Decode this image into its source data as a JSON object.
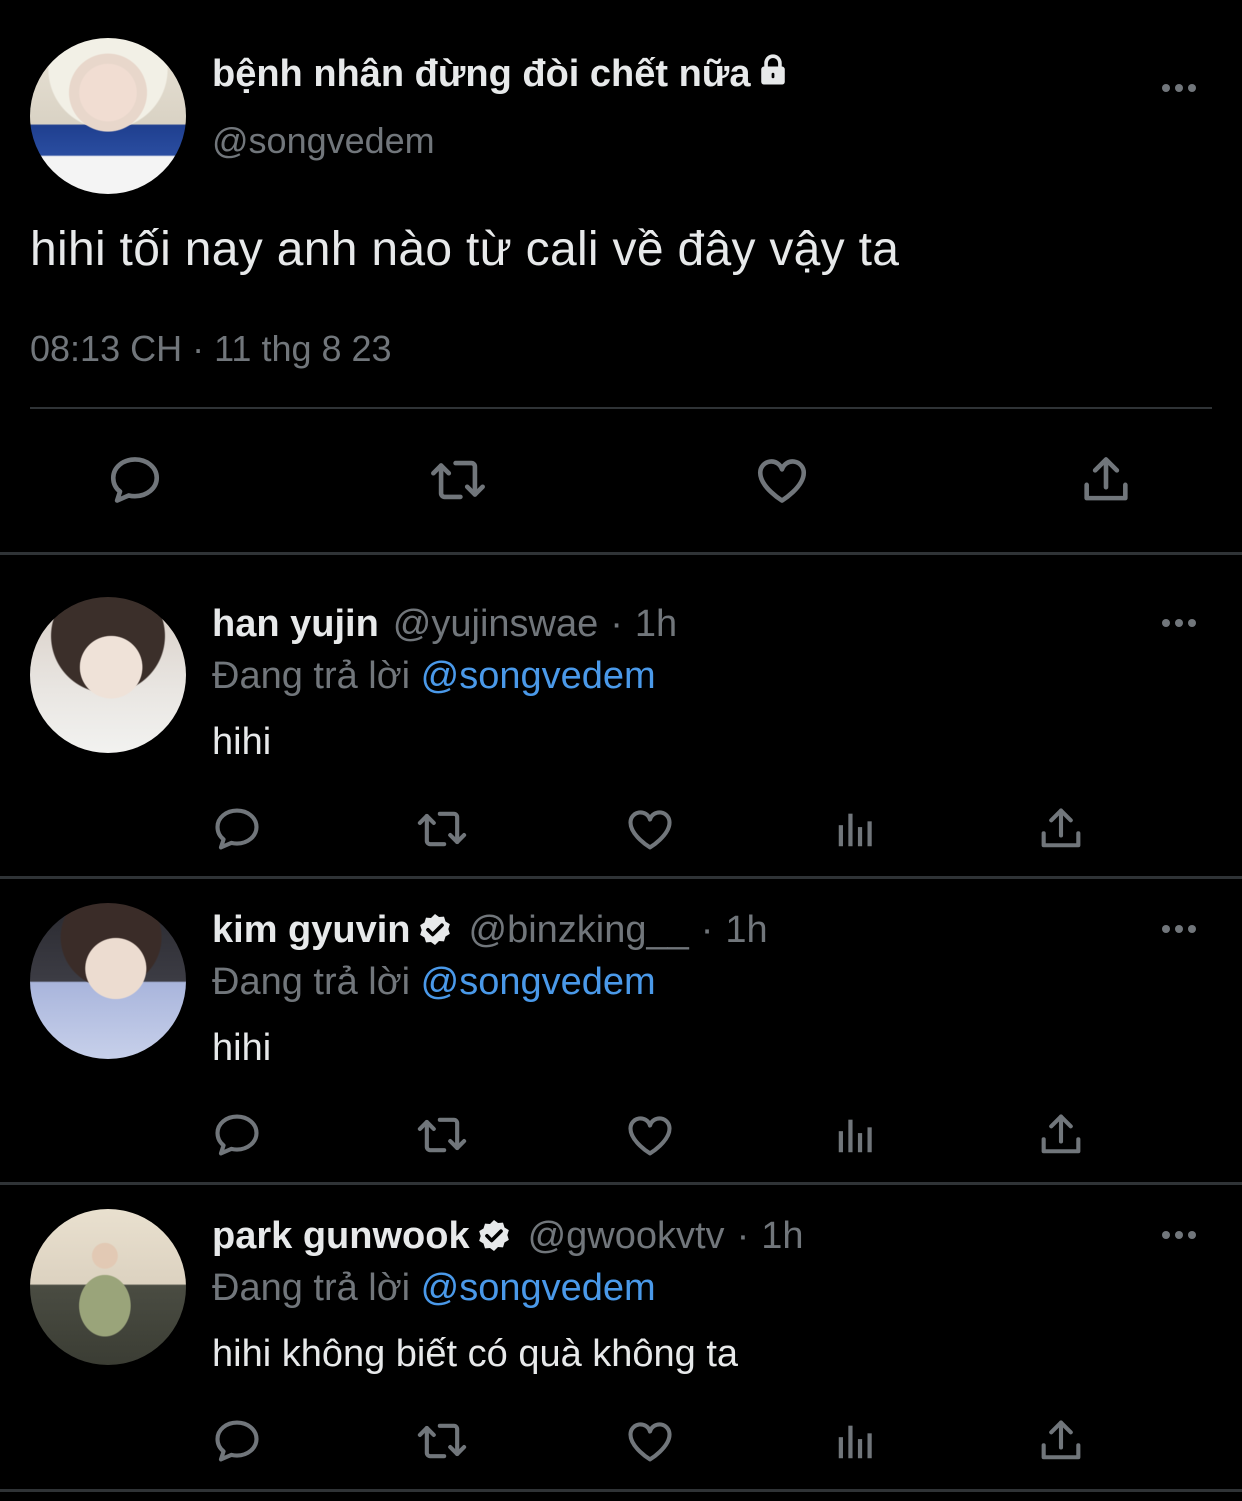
{
  "main_tweet": {
    "display_name": "bệnh nhân đừng đòi chết nữa",
    "handle": "@songvedem",
    "text": "hihi tối nay anh nào từ cali về đây vậy ta",
    "timestamp": "08:13 CH · 11 thg 8 23",
    "actions": [
      "reply-icon",
      "retweet-icon",
      "like-icon",
      "share-icon"
    ]
  },
  "replies": [
    {
      "display_name": "han yujin",
      "verified": false,
      "handle": "@yujinswae",
      "time_sep": "·",
      "ago": "1h",
      "replying_prefix": "Đang trả lời",
      "replying_to": "@songvedem",
      "text": "hihi"
    },
    {
      "display_name": "kim gyuvin",
      "verified": true,
      "handle": "@binzking__",
      "time_sep": "·",
      "ago": "1h",
      "replying_prefix": "Đang trả lời",
      "replying_to": "@songvedem",
      "text": "hihi"
    },
    {
      "display_name": "park gunwook",
      "verified": true,
      "handle": "@gwookvtv",
      "time_sep": "·",
      "ago": "1h",
      "replying_prefix": "Đang trả lời",
      "replying_to": "@songvedem",
      "text": "hihi không biết có quà không ta"
    }
  ],
  "colors": {
    "background": "#000000",
    "text": "#e7e9ea",
    "muted": "#71767b",
    "mention": "#4a99e9",
    "divider": "#2f3336"
  }
}
